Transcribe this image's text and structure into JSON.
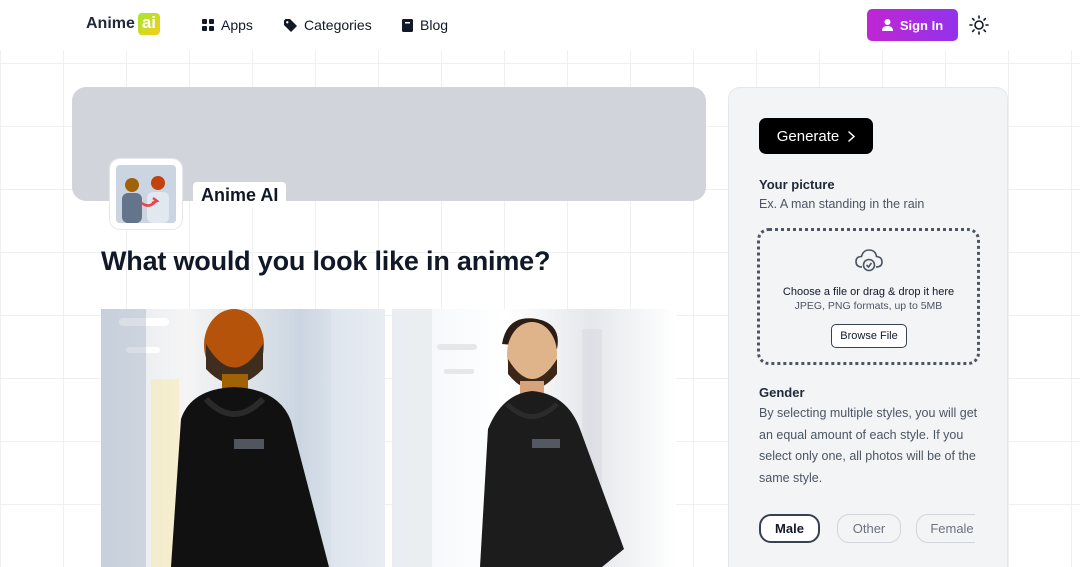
{
  "header": {
    "logo_text": "Anime",
    "logo_badge": "ai",
    "nav": [
      {
        "label": "Apps",
        "icon": "grid-icon"
      },
      {
        "label": "Categories",
        "icon": "tag-icon"
      },
      {
        "label": "Blog",
        "icon": "book-icon"
      }
    ],
    "signin_label": "Sign In",
    "signin_color": "#a21caf"
  },
  "app": {
    "name": "Anime AI",
    "headline": "What would you look like in anime?"
  },
  "panel": {
    "generate_label": "Generate",
    "picture_label": "Your picture",
    "picture_hint": "Ex. A man standing in the rain",
    "dropzone_title": "Choose a file or drag & drop it here",
    "dropzone_sub": "JPEG, PNG formats, up to 5MB",
    "browse_label": "Browse File",
    "gender_label": "Gender",
    "gender_hint": "By selecting multiple styles, you will get an equal amount of each style. If you select only one, all photos will be of the same style.",
    "gender_options": [
      {
        "label": "Male",
        "selected": true
      },
      {
        "label": "Other",
        "selected": false
      },
      {
        "label": "Female",
        "selected": false
      }
    ]
  }
}
